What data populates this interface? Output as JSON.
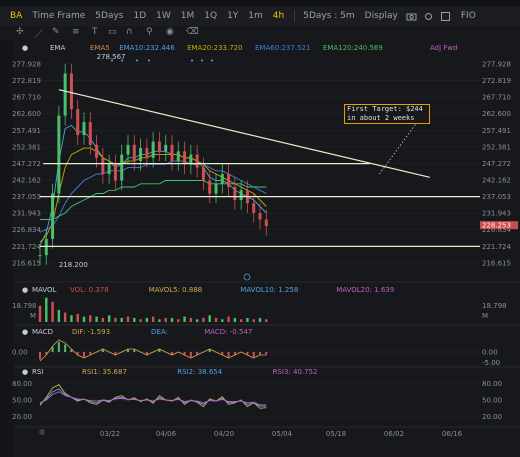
{
  "header": {
    "symbol": "BA",
    "timeframe_label": "Time Frame",
    "timeframes": [
      "5Days",
      "1D",
      "1W",
      "1M",
      "1Q",
      "1Y",
      "1m",
      "4h"
    ],
    "active_timeframe": "4h",
    "range_select": "5Days : 5m",
    "display_label": "Display",
    "right_label": "FIO"
  },
  "indicators": {
    "ema": {
      "name": "EMA",
      "items": [
        {
          "label": "EMA5",
          "value": "",
          "color": "#d68a4a"
        },
        {
          "label": "EMA10:",
          "value": "232.446",
          "color": "#4fa3e0"
        },
        {
          "label": "EMA20:",
          "value": "233.720",
          "color": "#c8a800"
        },
        {
          "label": "EMA60:",
          "value": "237.521",
          "color": "#3f7fe0"
        },
        {
          "label": "EMA120:",
          "value": "240.569",
          "color": "#4bbf6a"
        }
      ],
      "adj": "Adj Fwd"
    },
    "mavol": {
      "name": "MAVOL",
      "items": [
        {
          "label": "VOL:",
          "value": "0.378",
          "color": "#c94d4d"
        },
        {
          "label": "MAVOL5:",
          "value": "0.888",
          "color": "#d6a84a"
        },
        {
          "label": "MAVOL10:",
          "value": "1.258",
          "color": "#4fa3e0"
        },
        {
          "label": "MAVOL20:",
          "value": "1.639",
          "color": "#c060c0"
        }
      ]
    },
    "macd": {
      "name": "MACD",
      "items": [
        {
          "label": "DIF:",
          "value": "-1.593",
          "color": "#d6a84a"
        },
        {
          "label": "DEA:",
          "value": "",
          "color": "#4fa3e0"
        },
        {
          "label": "MACD:",
          "value": "-0.547",
          "color": "#c060c0"
        }
      ]
    },
    "rsi": {
      "name": "RSI",
      "items": [
        {
          "label": "RSI1:",
          "value": "35.687",
          "color": "#d6a84a"
        },
        {
          "label": "RSI2:",
          "value": "38.654",
          "color": "#4fa3e0"
        },
        {
          "label": "RSI3:",
          "value": "40.752",
          "color": "#c060c0"
        }
      ]
    }
  },
  "annotation": {
    "line1": "First Target: $244",
    "line2": "in about 2 weeks"
  },
  "markers": {
    "high": "278.567",
    "low": "218.200",
    "last_price": "228.253"
  },
  "chart_data": {
    "type": "line",
    "title": "BA 4h",
    "price_axis_ticks": [
      277.928,
      272.819,
      267.71,
      262.6,
      257.491,
      252.381,
      247.272,
      242.162,
      237.053,
      231.943,
      226.834,
      221.724,
      216.615
    ],
    "price_range": [
      213.5,
      281.0
    ],
    "date_ticks": [
      "03/22",
      "04/06",
      "04/20",
      "05/04",
      "05/18",
      "06/02",
      "06/16"
    ],
    "close_series": [
      {
        "t": 0,
        "v": 219
      },
      {
        "t": 2,
        "v": 224
      },
      {
        "t": 4,
        "v": 238
      },
      {
        "t": 6,
        "v": 262
      },
      {
        "t": 8,
        "v": 275
      },
      {
        "t": 10,
        "v": 264
      },
      {
        "t": 12,
        "v": 256
      },
      {
        "t": 14,
        "v": 260
      },
      {
        "t": 16,
        "v": 253
      },
      {
        "t": 18,
        "v": 249
      },
      {
        "t": 20,
        "v": 244
      },
      {
        "t": 22,
        "v": 247
      },
      {
        "t": 24,
        "v": 242
      },
      {
        "t": 26,
        "v": 250
      },
      {
        "t": 28,
        "v": 253
      },
      {
        "t": 30,
        "v": 248
      },
      {
        "t": 32,
        "v": 252
      },
      {
        "t": 34,
        "v": 249
      },
      {
        "t": 36,
        "v": 254
      },
      {
        "t": 38,
        "v": 251
      },
      {
        "t": 40,
        "v": 253
      },
      {
        "t": 42,
        "v": 248
      },
      {
        "t": 44,
        "v": 251
      },
      {
        "t": 46,
        "v": 247
      },
      {
        "t": 48,
        "v": 250
      },
      {
        "t": 50,
        "v": 246
      },
      {
        "t": 52,
        "v": 242
      },
      {
        "t": 54,
        "v": 238
      },
      {
        "t": 56,
        "v": 241
      },
      {
        "t": 58,
        "v": 244
      },
      {
        "t": 60,
        "v": 240
      },
      {
        "t": 62,
        "v": 236
      },
      {
        "t": 64,
        "v": 239
      },
      {
        "t": 66,
        "v": 235
      },
      {
        "t": 68,
        "v": 232
      },
      {
        "t": 70,
        "v": 230
      },
      {
        "t": 72,
        "v": 228
      }
    ],
    "ema_series": [
      {
        "name": "EMA10",
        "color": "#4fa3e0",
        "values": [
          222,
          226,
          234,
          248,
          258,
          259,
          257,
          257,
          255,
          252,
          249,
          248,
          246,
          247,
          249,
          249,
          250,
          250,
          251,
          251,
          251,
          250,
          250,
          249,
          249,
          248,
          246,
          243,
          242,
          242,
          241,
          239,
          238,
          237,
          236,
          234,
          232
        ]
      },
      {
        "name": "EMA20",
        "color": "#c8a800",
        "values": [
          223,
          225,
          229,
          238,
          246,
          250,
          251,
          252,
          252,
          251,
          249,
          248,
          247,
          247,
          248,
          248,
          249,
          249,
          250,
          250,
          250,
          250,
          250,
          249,
          249,
          248,
          247,
          245,
          244,
          243,
          242,
          241,
          240,
          239,
          238,
          236,
          234
        ]
      },
      {
        "name": "EMA60",
        "color": "#3f7fe0",
        "values": [
          226,
          227,
          228,
          231,
          235,
          238,
          240,
          242,
          243,
          244,
          244,
          245,
          245,
          245,
          246,
          246,
          246,
          247,
          247,
          247,
          247,
          248,
          248,
          248,
          247,
          247,
          247,
          246,
          245,
          245,
          244,
          243,
          242,
          241,
          240,
          239,
          238
        ]
      },
      {
        "name": "EMA120",
        "color": "#4bbf6a",
        "values": [
          230,
          230,
          230,
          231,
          232,
          234,
          235,
          236,
          237,
          238,
          238,
          239,
          239,
          240,
          240,
          240,
          241,
          241,
          241,
          241,
          242,
          242,
          242,
          242,
          242,
          242,
          242,
          241,
          241,
          241,
          241,
          241,
          241,
          240,
          240,
          240,
          240
        ]
      }
    ],
    "trendlines": [
      {
        "name": "descending",
        "from": [
          6,
          270
        ],
        "to": [
          124,
          243
        ],
        "color": "#e6f0c8"
      },
      {
        "name": "resistance",
        "from": [
          1,
          247.2
        ],
        "to": [
          105,
          247.2
        ],
        "color": "#e6f0c8"
      },
      {
        "name": "support",
        "from": [
          0,
          237.05
        ],
        "to": [
          140,
          237.05
        ],
        "color": "#e6f0c8"
      },
      {
        "name": "bottom",
        "from": [
          0,
          221.7
        ],
        "to": [
          140,
          221.7
        ],
        "color": "#e6f0c8"
      },
      {
        "name": "dotted",
        "from": [
          108,
          244
        ],
        "to": [
          120,
          260
        ],
        "color": "#cfd2d6"
      }
    ],
    "volume_axis": {
      "max": "18.798",
      "unit": "M"
    },
    "volume_values": [
      12,
      18,
      15,
      9,
      7,
      5,
      6,
      4,
      5,
      4,
      3,
      5,
      3,
      3,
      4,
      3,
      2,
      3,
      4,
      2,
      3,
      3,
      2,
      4,
      3,
      2,
      3,
      5,
      3,
      2,
      4,
      3,
      2,
      3,
      2,
      3,
      2
    ],
    "macd_axis": {
      "labels": [
        "0.00",
        "-5.00"
      ]
    },
    "macd_hist": [
      -3,
      -1,
      2,
      4,
      3,
      1,
      -1,
      -2,
      -1,
      0,
      1,
      0,
      -1,
      0,
      1,
      1,
      0,
      -1,
      0,
      1,
      0,
      -1,
      0,
      -1,
      -2,
      -1,
      0,
      1,
      0,
      -1,
      -2,
      -1,
      0,
      -1,
      -2,
      -1,
      -1
    ],
    "rsi_axis": {
      "labels": [
        "80.00",
        "50.00",
        "20.00"
      ]
    },
    "rsi_series": [
      {
        "name": "RSI1",
        "color": "#d6a84a",
        "values": [
          40,
          55,
          72,
          78,
          62,
          55,
          48,
          52,
          45,
          42,
          50,
          46,
          55,
          58,
          50,
          54,
          47,
          52,
          44,
          58,
          50,
          48,
          55,
          42,
          50,
          46,
          38,
          52,
          48,
          56,
          42,
          45,
          50,
          38,
          45,
          35,
          36
        ]
      },
      {
        "name": "RSI2",
        "color": "#4fa3e0",
        "values": [
          42,
          52,
          65,
          70,
          60,
          55,
          50,
          51,
          47,
          45,
          49,
          48,
          53,
          55,
          51,
          52,
          48,
          51,
          47,
          54,
          50,
          49,
          52,
          45,
          49,
          47,
          42,
          50,
          48,
          53,
          45,
          46,
          49,
          42,
          45,
          39,
          39
        ]
      },
      {
        "name": "RSI3",
        "color": "#c060c0",
        "values": [
          45,
          50,
          60,
          65,
          58,
          55,
          52,
          51,
          49,
          48,
          50,
          49,
          52,
          53,
          51,
          51,
          49,
          50,
          48,
          52,
          50,
          49,
          51,
          47,
          49,
          48,
          45,
          49,
          48,
          51,
          47,
          47,
          48,
          45,
          46,
          41,
          41
        ]
      }
    ]
  }
}
